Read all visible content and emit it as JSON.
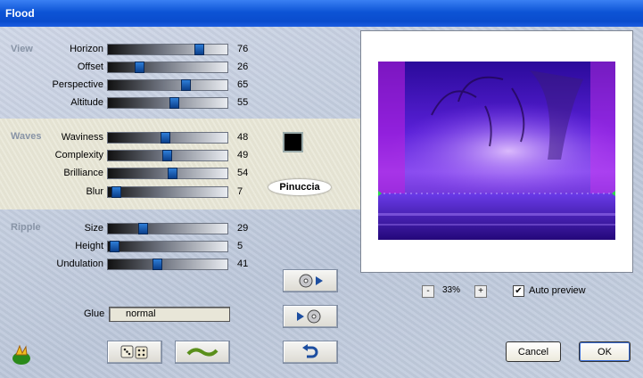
{
  "window": {
    "title": "Flood"
  },
  "sections": {
    "view": "View",
    "waves": "Waves",
    "ripple": "Ripple"
  },
  "sliders": [
    {
      "label": "Horizon",
      "value": "76"
    },
    {
      "label": "Offset",
      "value": "26"
    },
    {
      "label": "Perspective",
      "value": "65"
    },
    {
      "label": "Altitude",
      "value": "55"
    },
    {
      "label": "Waviness",
      "value": "48"
    },
    {
      "label": "Complexity",
      "value": "49"
    },
    {
      "label": "Brilliance",
      "value": "54"
    },
    {
      "label": "Blur",
      "value": "7"
    },
    {
      "label": "Size",
      "value": "29"
    },
    {
      "label": "Height",
      "value": "5"
    },
    {
      "label": "Undulation",
      "value": "41"
    }
  ],
  "color_swatch": "#000000",
  "logo_text": "Pinuccia",
  "glue": {
    "label": "Glue",
    "value": "normal"
  },
  "zoom": {
    "value": "33%",
    "minus": "-",
    "plus": "+"
  },
  "auto_preview": {
    "label": "Auto preview",
    "checked": true,
    "mark": "✔"
  },
  "buttons": {
    "cancel": "Cancel",
    "ok": "OK"
  },
  "icons": [
    "app-icon",
    "dice-icon",
    "wave-icon",
    "cd-next-icon",
    "cd-prev-icon",
    "undo-icon"
  ]
}
